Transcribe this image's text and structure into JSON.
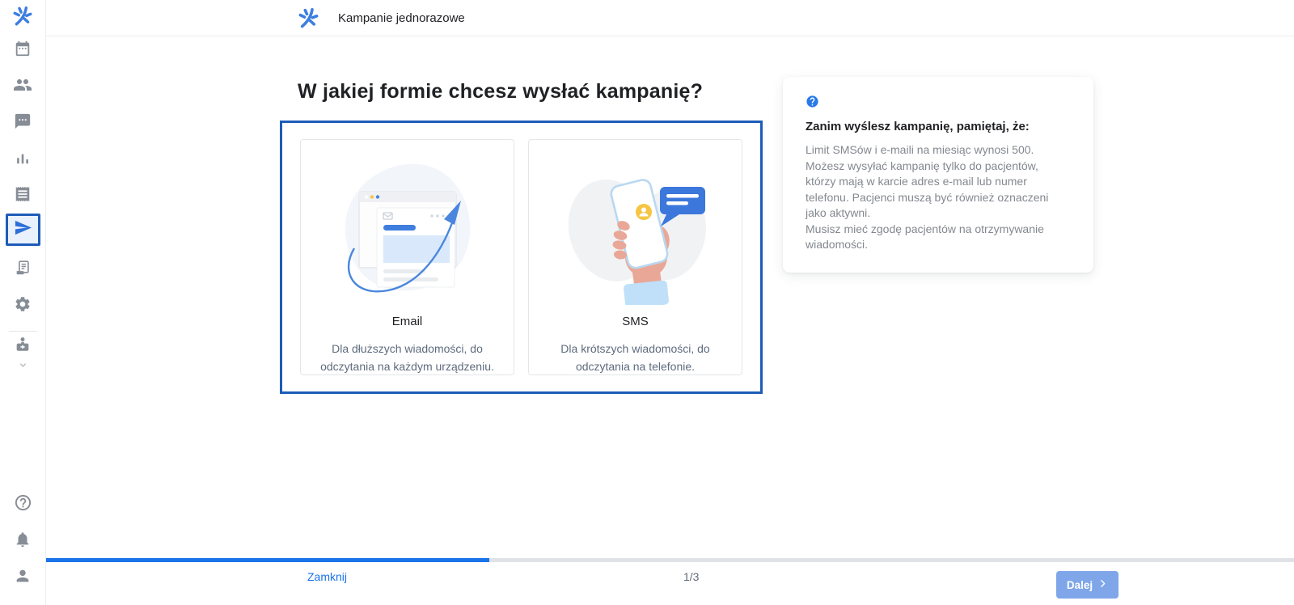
{
  "page": {
    "title": "Kampanie jednorazowe"
  },
  "sidebar": {
    "active_item": "campaigns",
    "items": [
      {
        "name": "calendar",
        "icon": "calendar-icon"
      },
      {
        "name": "patients",
        "icon": "people-icon"
      },
      {
        "name": "messages",
        "icon": "chat-icon"
      },
      {
        "name": "statistics",
        "icon": "bar-chart-icon"
      },
      {
        "name": "records",
        "icon": "receipt-icon"
      },
      {
        "name": "campaigns",
        "icon": "send-icon",
        "active": true
      },
      {
        "name": "terminal",
        "icon": "terminal-icon"
      },
      {
        "name": "settings",
        "icon": "gear-icon"
      },
      {
        "name": "staff",
        "icon": "doctor-icon"
      },
      {
        "name": "help",
        "icon": "help-icon"
      },
      {
        "name": "notifications",
        "icon": "bell-icon"
      },
      {
        "name": "account",
        "icon": "person-icon"
      }
    ]
  },
  "main": {
    "heading": "W jakiej formie chcesz wysłać kampanię?",
    "options": [
      {
        "title": "Email",
        "description": "Dla dłuższych wiadomości, do odczytania na każdym urządzeniu.",
        "illustration": "email-browser-arrow"
      },
      {
        "title": "SMS",
        "description": "Dla krótszych wiadomości, do odczytania na telefonie.",
        "illustration": "hand-phone-message"
      }
    ]
  },
  "info_panel": {
    "icon": "help-circle-icon",
    "title": "Zanim wyślesz kampanię, pamiętaj, że:",
    "lines": [
      "Limit SMSów i e-maili na miesiąc wynosi 500.",
      "Możesz wysyłać kampanię tylko do pacjentów, którzy mają w karcie adres e-mail lub numer telefonu. Pacjenci muszą być również oznaczeni jako aktywni.",
      "Musisz mieć zgodę pacjentów na otrzymywanie wiadomości."
    ]
  },
  "footer": {
    "close_label": "Zamknij",
    "step_indicator": "1/3",
    "next_label": "Dalej",
    "progress_percent": 35.5
  },
  "colors": {
    "accent_blue": "#1a73e8",
    "selection_border": "#1d5cb8",
    "next_button_bg": "#7ea6e9",
    "sidebar_icon_gray": "#878d96"
  }
}
